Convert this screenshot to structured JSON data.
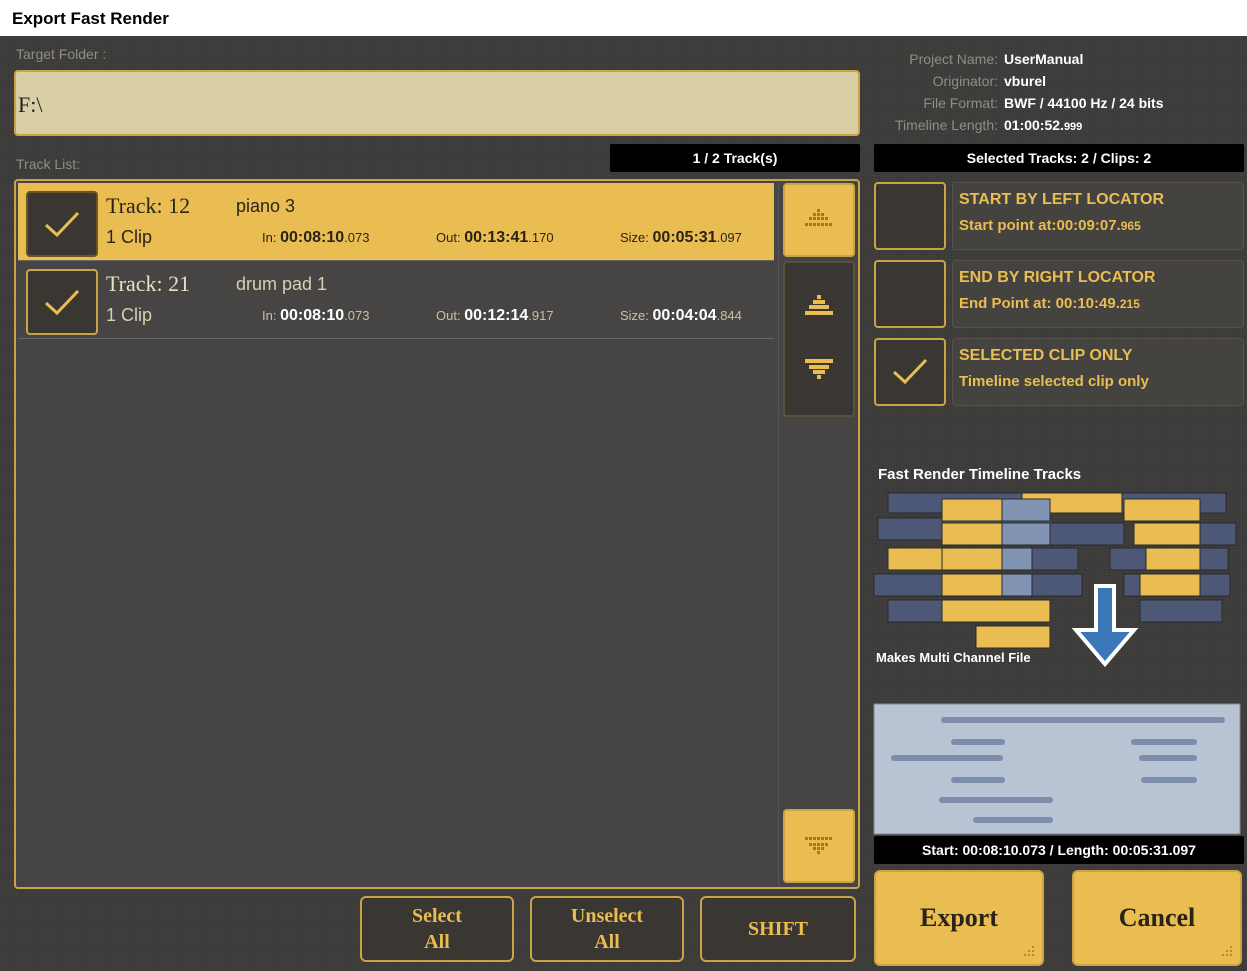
{
  "window": {
    "title": "Export Fast Render"
  },
  "target_folder": {
    "label": "Target Folder :",
    "value": "F:\\"
  },
  "project": {
    "rows": [
      {
        "key": "Project Name:",
        "value": "UserManual",
        "ms": ""
      },
      {
        "key": "Originator:",
        "value": "vburel",
        "ms": ""
      },
      {
        "key": "File Format:",
        "value": "BWF / 44100 Hz / 24 bits",
        "ms": ""
      },
      {
        "key": "Timeline Length:",
        "value": "01:00:52.",
        "ms": "999"
      }
    ]
  },
  "track_list": {
    "label": "Track List:",
    "count": "1 / 2 Track(s)",
    "tracks": [
      {
        "name": "Track: 12",
        "desc": "piano 3",
        "clips": "1 Clip",
        "in_label": "In:",
        "in": "00:08:10",
        "in_ms": ".073",
        "out_label": "Out:",
        "out": "00:13:41",
        "out_ms": ".170",
        "size_label": "Size:",
        "size": "00:05:31",
        "size_ms": ".097",
        "selected": true,
        "checked": true
      },
      {
        "name": "Track: 21",
        "desc": "drum pad 1",
        "clips": "1 Clip",
        "in_label": "In:",
        "in": "00:08:10",
        "in_ms": ".073",
        "out_label": "Out:",
        "out": "00:12:14",
        "out_ms": ".917",
        "size_label": "Size:",
        "size": "00:04:04",
        "size_ms": ".844",
        "selected": false,
        "checked": true
      }
    ]
  },
  "buttons": {
    "select_all_1": "Select",
    "select_all_2": "All",
    "unselect_all_1": "Unselect",
    "unselect_all_2": "All",
    "shift": "SHIFT",
    "export": "Export",
    "cancel": "Cancel"
  },
  "selection": {
    "summary": "Selected Tracks: 2 / Clips: 2"
  },
  "options": [
    {
      "title": "START BY LEFT LOCATOR",
      "sub": "Start point at:00:09:07.",
      "sub_ms": "965",
      "checked": false
    },
    {
      "title": "END BY RIGHT LOCATOR",
      "sub": "End Point at:  00:10:49.",
      "sub_ms": "215",
      "checked": false
    },
    {
      "title": "SELECTED CLIP ONLY",
      "sub": "Timeline selected clip only",
      "sub_ms": "",
      "checked": true
    }
  ],
  "illustration": {
    "title": "Fast Render Timeline Tracks",
    "caption": "Makes Multi Channel File"
  },
  "footer": {
    "range": "Start: 00:08:10.073 / Length: 00:05:31.097"
  },
  "colors": {
    "accent": "#e9bd52",
    "border": "#c9a445",
    "bg": "#3c3b39",
    "arrow": "#3c78b8"
  }
}
